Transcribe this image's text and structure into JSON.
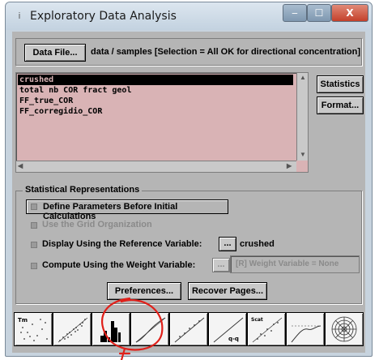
{
  "window": {
    "title": "Exploratory Data Analysis",
    "controls": {
      "minimize": "‒",
      "maximize": "☐",
      "close": "X"
    }
  },
  "header": {
    "data_file_button": "Data File...",
    "data_path": "data / samples [Selection = All OK for directional concentration]"
  },
  "variables": {
    "items": [
      {
        "label": "crushed",
        "selected": true
      },
      {
        "label": "total nb COR fract geol",
        "selected": false
      },
      {
        "label": "FF_true_COR",
        "selected": false
      },
      {
        "label": "FF_corregidio_COR",
        "selected": false
      }
    ]
  },
  "side_buttons": {
    "statistics": "Statistics",
    "format": "Format..."
  },
  "stat_reps": {
    "title": "Statistical Representations",
    "define_params": "Define Parameters Before Initial Calculations",
    "use_grid": "Use the Grid Organization",
    "display_ref": "Display Using the Reference Variable:",
    "ref_button": "...",
    "ref_value": "crushed",
    "compute_weight": "Compute Using the Weight Variable:",
    "weight_button": "...",
    "weight_value": "[R] Weight Variable = None",
    "preferences": "Preferences...",
    "recover_pages": "Recover Pages..."
  },
  "tool_icons": [
    {
      "name": "base-map-icon",
      "label": "Tm"
    },
    {
      "name": "scatter-plot-icon",
      "label": ""
    },
    {
      "name": "histogram-icon",
      "label": ""
    },
    {
      "name": "cumulative-curve-icon",
      "label": ""
    },
    {
      "name": "probability-plot-icon",
      "label": ""
    },
    {
      "name": "qq-plot-icon",
      "label": "q-q"
    },
    {
      "name": "h-scatter-plot-icon",
      "label": "Scat"
    },
    {
      "name": "variogram-icon",
      "label": ""
    },
    {
      "name": "variogram-map-icon",
      "label": ""
    }
  ],
  "colors": {
    "list_background": "#d9b3b5",
    "panel_background": "#b5b5b5",
    "annotation_red": "#e0201a"
  }
}
